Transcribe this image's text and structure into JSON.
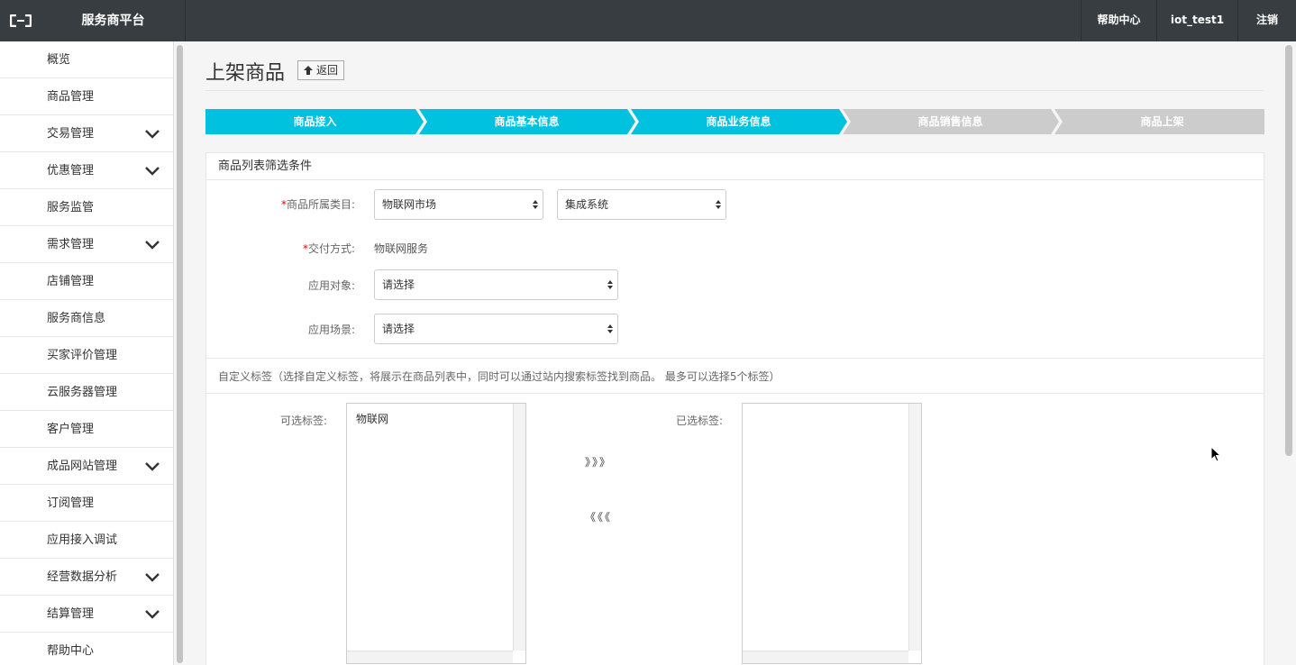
{
  "topbar": {
    "logo_icon": "aliyun-logo-icon",
    "brand": "服务商平台",
    "nav": [
      "帮助中心",
      "iot_test1",
      "注销"
    ]
  },
  "sidebar": {
    "items": [
      {
        "label": "概览",
        "expandable": false
      },
      {
        "label": "商品管理",
        "expandable": false
      },
      {
        "label": "交易管理",
        "expandable": true
      },
      {
        "label": "优惠管理",
        "expandable": true
      },
      {
        "label": "服务监管",
        "expandable": false
      },
      {
        "label": "需求管理",
        "expandable": true
      },
      {
        "label": "店铺管理",
        "expandable": false
      },
      {
        "label": "服务商信息",
        "expandable": false
      },
      {
        "label": "买家评价管理",
        "expandable": false
      },
      {
        "label": "云服务器管理",
        "expandable": false
      },
      {
        "label": "客户管理",
        "expandable": false
      },
      {
        "label": "成品网站管理",
        "expandable": true
      },
      {
        "label": "订阅管理",
        "expandable": false
      },
      {
        "label": "应用接入调试",
        "expandable": false
      },
      {
        "label": "经营数据分析",
        "expandable": true
      },
      {
        "label": "结算管理",
        "expandable": true
      },
      {
        "label": "帮助中心",
        "expandable": false
      }
    ]
  },
  "page": {
    "title": "上架商品",
    "back_label": "返回"
  },
  "steps": {
    "active_color": "#00c1de",
    "inactive_color": "#cccccc",
    "items": [
      {
        "label": "商品接入",
        "active": true
      },
      {
        "label": "商品基本信息",
        "active": true
      },
      {
        "label": "商品业务信息",
        "active": true
      },
      {
        "label": "商品销售信息",
        "active": false
      },
      {
        "label": "商品上架",
        "active": false
      }
    ]
  },
  "filter": {
    "header": "商品列表筛选条件",
    "category_label": "商品所属类目:",
    "category_value_1": "物联网市场",
    "category_value_2": "集成系统",
    "delivery_label": "交付方式:",
    "delivery_value": "物联网服务",
    "target_label": "应用对象:",
    "target_value": "请选择",
    "scene_label": "应用场景:",
    "scene_value": "请选择",
    "required_mark": "*"
  },
  "tags": {
    "note": "自定义标签（选择自定义标签，将展示在商品列表中，同时可以通过站内搜索标签找到商品。 最多可以选择5个标签）",
    "available_label": "可选标签:",
    "available_options": [
      "物联网"
    ],
    "selected_label": "已选标签:",
    "add_label": "》》》",
    "remove_label": "《《《"
  }
}
